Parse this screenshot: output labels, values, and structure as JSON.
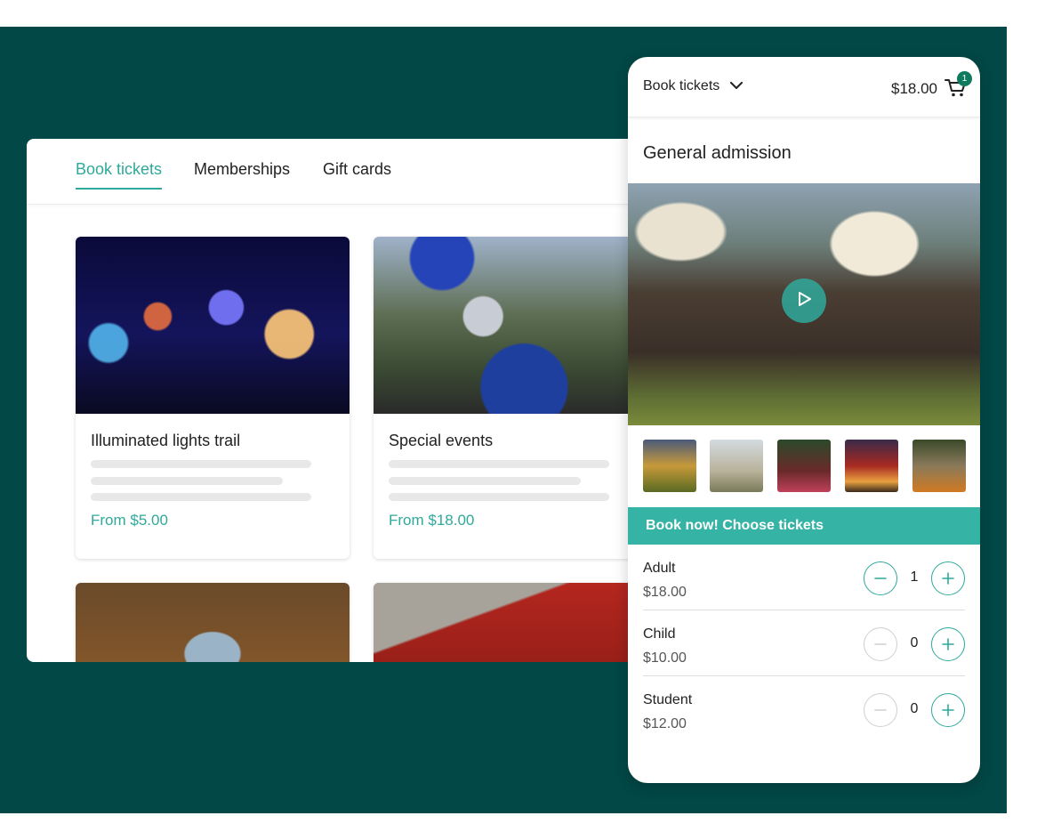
{
  "colors": {
    "background": "#024846",
    "accent": "#2fa99b",
    "book_bar": "#35b3a4",
    "cart_badge": "#0f7a5e"
  },
  "tabs": [
    {
      "label": "Book tickets",
      "active": true
    },
    {
      "label": "Memberships",
      "active": false
    },
    {
      "label": "Gift cards",
      "active": false
    }
  ],
  "cards": [
    {
      "title": "Illuminated lights trail",
      "price": "From $5.00",
      "image": "lights-trail-photo"
    },
    {
      "title": "Special events",
      "price": "From $18.00",
      "image": "knight-horse-photo"
    },
    {
      "image": "pumpkin-patch-photo"
    },
    {
      "image": "red-barn-photo"
    }
  ],
  "phone": {
    "dropdown_label": "Book tickets",
    "cart_total": "$18.00",
    "cart_count": "1",
    "title": "General admission",
    "hero_image": "festival-crowd-photo",
    "thumbnails": [
      "sunflower-field",
      "couple-field",
      "flower-garden",
      "red-barn-night",
      "pumpkin-patch"
    ],
    "book_bar_label": "Book now! Choose tickets",
    "tickets": [
      {
        "name": "Adult",
        "price": "$18.00",
        "qty": "1",
        "minus_enabled": true
      },
      {
        "name": "Child",
        "price": "$10.00",
        "qty": "0",
        "minus_enabled": false
      },
      {
        "name": "Student",
        "price": "$12.00",
        "qty": "0",
        "minus_enabled": false
      }
    ]
  }
}
